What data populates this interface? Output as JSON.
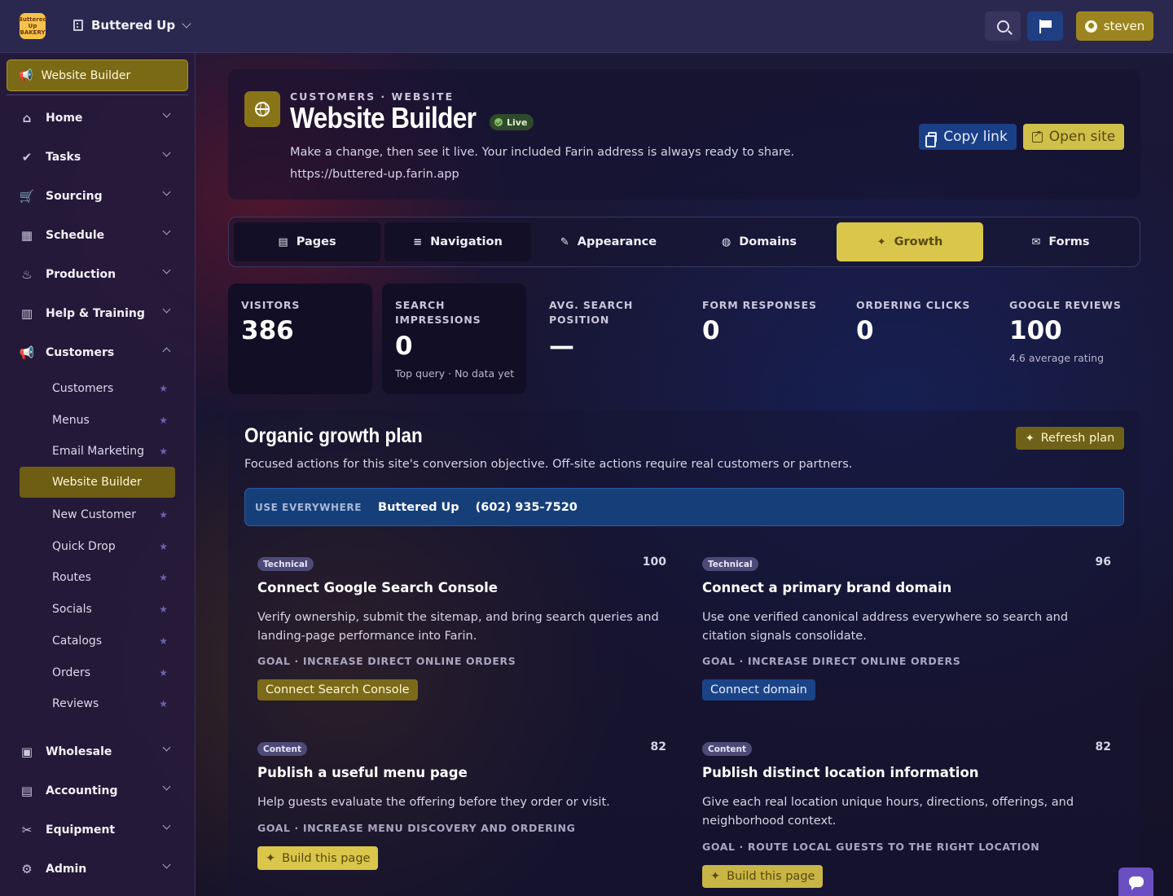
{
  "topbar": {
    "logo_text": "Buttered Up BAKERY",
    "org_name": "Buttered Up",
    "user_label": "steven"
  },
  "sidebar": {
    "active_section": "Website Builder",
    "items": [
      {
        "label": "Home",
        "icon": "home-icon"
      },
      {
        "label": "Tasks",
        "icon": "check-circle-icon"
      },
      {
        "label": "Sourcing",
        "icon": "cart-icon"
      },
      {
        "label": "Schedule",
        "icon": "calendar-icon"
      },
      {
        "label": "Production",
        "icon": "cake-icon"
      },
      {
        "label": "Help & Training",
        "icon": "book-icon"
      },
      {
        "label": "Customers",
        "icon": "megaphone-icon"
      }
    ],
    "sub_items": [
      "Customers",
      "Menus",
      "Email Marketing",
      "Website Builder",
      "New Customer",
      "Quick Drop",
      "Routes",
      "Socials",
      "Catalogs",
      "Orders",
      "Reviews"
    ],
    "lower_items": [
      {
        "label": "Wholesale",
        "icon": "money-icon"
      },
      {
        "label": "Accounting",
        "icon": "calculator-icon"
      },
      {
        "label": "Equipment",
        "icon": "tools-icon"
      },
      {
        "label": "Admin",
        "icon": "gear-icon"
      }
    ]
  },
  "header": {
    "eyebrow": "CUSTOMERS · WEBSITE",
    "title": "Website Builder",
    "badge": "Live",
    "description": "Make a change, then see it live. Your included Farin address is always ready to share.",
    "url": "https://buttered-up.farin.app",
    "copy_label": "Copy link",
    "open_label": "Open site"
  },
  "tabs": [
    {
      "label": "Pages",
      "icon": "file-icon"
    },
    {
      "label": "Navigation",
      "icon": "menu-icon"
    },
    {
      "label": "Appearance",
      "icon": "brush-icon"
    },
    {
      "label": "Domains",
      "icon": "globe-icon"
    },
    {
      "label": "Growth",
      "icon": "sparkle-icon",
      "active": true
    },
    {
      "label": "Forms",
      "icon": "envelope-icon"
    }
  ],
  "stats": [
    {
      "label": "VISITORS",
      "value": "386",
      "sub": ""
    },
    {
      "label": "SEARCH IMPRESSIONS",
      "value": "0",
      "sub": "Top query · No data yet"
    },
    {
      "label": "AVG. SEARCH POSITION",
      "value": "—",
      "sub": ""
    },
    {
      "label": "FORM RESPONSES",
      "value": "0",
      "sub": ""
    },
    {
      "label": "ORDERING CLICKS",
      "value": "0",
      "sub": ""
    },
    {
      "label": "GOOGLE REVIEWS",
      "value": "100",
      "sub": "4.6 average rating"
    }
  ],
  "plan": {
    "title": "Organic growth plan",
    "description": "Focused actions for this site's conversion objective. Off-site actions require real customers or partners.",
    "refresh_label": "Refresh plan",
    "use_everywhere_label": "USE EVERYWHERE",
    "brand_name": "Buttered Up",
    "phone": "(602) 935-7520",
    "recommendations": [
      {
        "tag": "Technical",
        "score": "100",
        "title": "Connect Google Search Console",
        "description": "Verify ownership, submit the sitemap, and bring search queries and landing-page performance into Farin.",
        "goal": "GOAL · INCREASE DIRECT ONLINE ORDERS",
        "action": "Connect Search Console"
      },
      {
        "tag": "Technical",
        "score": "96",
        "title": "Connect a primary brand domain",
        "description": "Use one verified canonical address everywhere so search and citation signals consolidate.",
        "goal": "GOAL · INCREASE DIRECT ONLINE ORDERS",
        "action": "Connect domain"
      },
      {
        "tag": "Content",
        "score": "82",
        "title": "Publish a useful menu page",
        "description": "Help guests evaluate the offering before they order or visit.",
        "goal": "GOAL · INCREASE MENU DISCOVERY AND ORDERING",
        "action": "Build this page"
      },
      {
        "tag": "Content",
        "score": "82",
        "title": "Publish distinct location information",
        "description": "Give each real location unique hours, directions, offerings, and neighborhood context.",
        "goal": "GOAL · ROUTE LOCAL GUESTS TO THE RIGHT LOCATION",
        "action": "Build this page"
      }
    ]
  }
}
